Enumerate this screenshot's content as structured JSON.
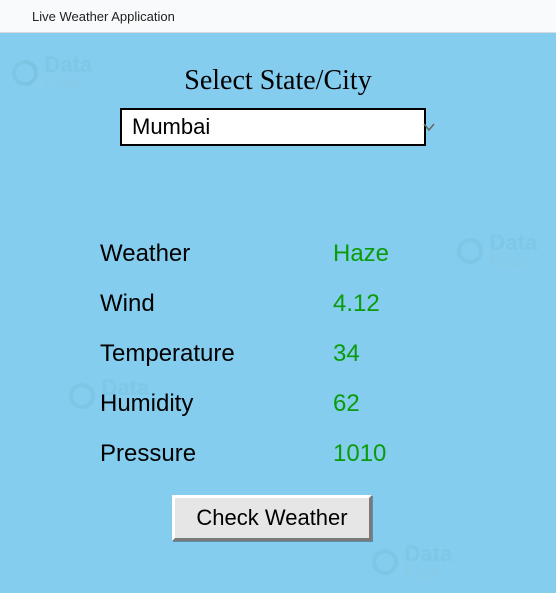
{
  "window": {
    "title": "Live Weather Application"
  },
  "heading": "Select State/City",
  "combo": {
    "value": "Mumbai "
  },
  "rows": [
    {
      "label": "Weather",
      "value": "Haze"
    },
    {
      "label": "Wind",
      "value": "4.12"
    },
    {
      "label": "Temperature",
      "value": "34"
    },
    {
      "label": "Humidity",
      "value": "62"
    },
    {
      "label": "Pressure",
      "value": "1010"
    }
  ],
  "button": {
    "label": "Check Weather"
  },
  "watermark": {
    "line1": "Data",
    "line2": "Flair"
  }
}
